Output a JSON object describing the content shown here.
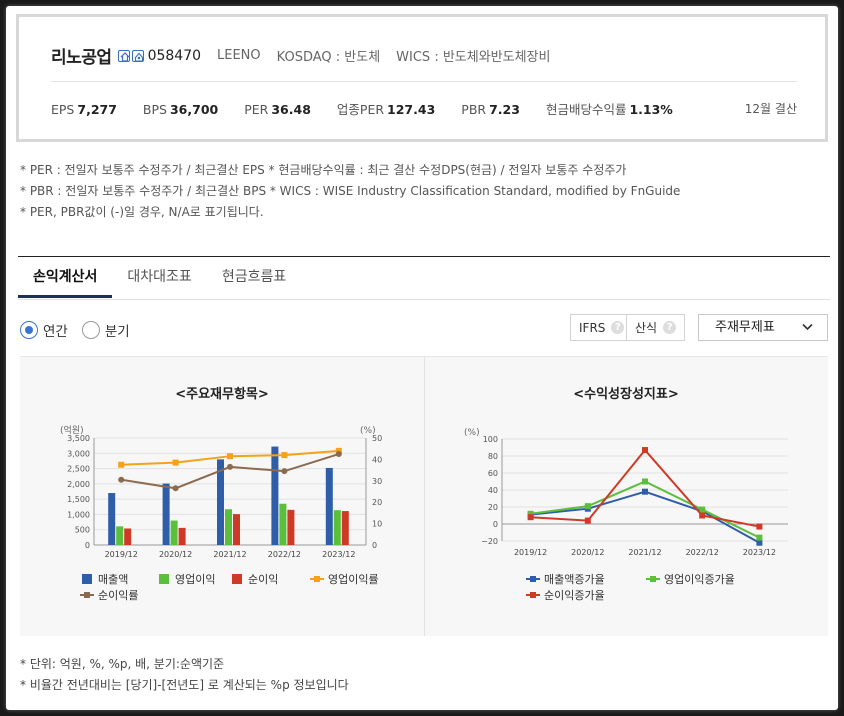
{
  "company": {
    "name": "리노공업",
    "code": "058470",
    "english_name": "LEENO",
    "market": "KOSDAQ : 반도체",
    "wics": "WICS : 반도체와반도체장비",
    "icons": [
      "home-icon",
      "company-icon"
    ]
  },
  "metrics": [
    {
      "label": "EPS",
      "value": "7,277"
    },
    {
      "label": "BPS",
      "value": "36,700"
    },
    {
      "label": "PER",
      "value": "36.48"
    },
    {
      "label": "업종PER",
      "value": "127.43"
    },
    {
      "label": "PBR",
      "value": "7.23"
    },
    {
      "label": "현금배당수익률",
      "value": "1.13%"
    }
  ],
  "settlement": "12월 결산",
  "notes": [
    "* PER : 전일자 보통주 수정주가 / 최근결산 EPS * 현금배당수익률 : 최근 결산 수정DPS(현금) / 전일자 보통주 수정주가",
    "* PBR : 전일자 보통주 수정주가 / 최근결산 BPS * WICS : WISE Industry Classification Standard, modified by FnGuide",
    "* PER, PBR값이 (-)일 경우, N/A로 표기됩니다."
  ],
  "tabs": [
    "손익계산서",
    "대차대조표",
    "현금흐름표"
  ],
  "period": {
    "annual": "연간",
    "quarter": "분기",
    "selected": "annual"
  },
  "options": {
    "ifrs": "IFRS",
    "calc": "산식",
    "help_glyph": "?",
    "select_value": "주재무제표"
  },
  "colors": {
    "blue": "#2f5ea8",
    "green": "#5cbf3c",
    "red": "#cf3a27",
    "orange": "#f5a21a",
    "brown": "#8c6a4f",
    "accent": "#3b73d1"
  },
  "chart_data": [
    {
      "type": "bar",
      "title": "<주요재무항목>",
      "ylabel": "(억원)",
      "y2label": "(%)",
      "categories": [
        "2019/12",
        "2020/12",
        "2021/12",
        "2022/12",
        "2023/12"
      ],
      "ylim": [
        0,
        3500
      ],
      "y_ticks": [
        "0",
        "500",
        "1,000",
        "1,500",
        "2,000",
        "2,500",
        "3,000",
        "3,500"
      ],
      "y2lim": [
        0,
        50
      ],
      "y2_ticks": [
        "0",
        "10",
        "20",
        "30",
        "40",
        "50"
      ],
      "series": [
        {
          "name": "매출액",
          "kind": "bar",
          "axis": "left",
          "color": "#2f5ea8",
          "values": [
            1700,
            2010,
            2800,
            3220,
            2520
          ]
        },
        {
          "name": "영업이익",
          "kind": "bar",
          "axis": "left",
          "color": "#5cbf3c",
          "values": [
            610,
            800,
            1170,
            1350,
            1140
          ]
        },
        {
          "name": "순이익",
          "kind": "bar",
          "axis": "left",
          "color": "#cf3a27",
          "values": [
            540,
            560,
            1010,
            1150,
            1110
          ]
        },
        {
          "name": "영업이익률",
          "kind": "line",
          "axis": "right",
          "color": "#f5a21a",
          "values": [
            37.5,
            38.5,
            41.5,
            42.0,
            44.0
          ]
        },
        {
          "name": "순이익률",
          "kind": "line",
          "axis": "right",
          "color": "#8c6a4f",
          "values": [
            30.5,
            26.5,
            36.5,
            34.5,
            42.5
          ]
        }
      ]
    },
    {
      "type": "line",
      "title": "<수익성장성지표>",
      "ylabel": "(%)",
      "categories": [
        "2019/12",
        "2020/12",
        "2021/12",
        "2022/12",
        "2023/12"
      ],
      "ylim": [
        -20,
        100
      ],
      "y_ticks": [
        "−20",
        "0",
        "20",
        "40",
        "60",
        "80",
        "100"
      ],
      "series": [
        {
          "name": "매출액증가율",
          "color": "#2f5ea8",
          "values": [
            11,
            18,
            38,
            15,
            -22
          ]
        },
        {
          "name": "영업이익증가율",
          "color": "#5cbf3c",
          "values": [
            12,
            21,
            50,
            17,
            -16
          ]
        },
        {
          "name": "순이익증가율",
          "color": "#cf3a27",
          "values": [
            8,
            4,
            87,
            10,
            -3
          ]
        }
      ]
    }
  ],
  "footer_notes": [
    "* 단위: 억원, %, %p, 배, 분기:순액기준",
    "* 비율간 전년대비는 [당기]-[전년도] 로 계산되는 %p 정보입니다"
  ]
}
